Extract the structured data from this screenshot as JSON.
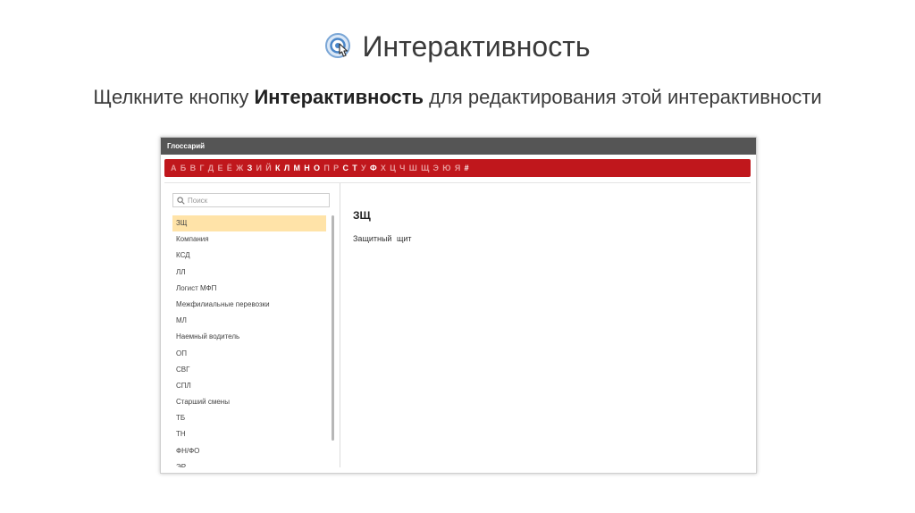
{
  "slide": {
    "title": "Интерактивность",
    "instruction_before": "Щелкните кнопку ",
    "instruction_bold": "Интерактивность",
    "instruction_after": " для редактирования этой интерактивности"
  },
  "glossary": {
    "header": "Глоссарий",
    "alphabet": [
      {
        "char": "А",
        "active": false
      },
      {
        "char": "Б",
        "active": false
      },
      {
        "char": "В",
        "active": false
      },
      {
        "char": "Г",
        "active": false
      },
      {
        "char": "Д",
        "active": false
      },
      {
        "char": "Е",
        "active": false
      },
      {
        "char": "Ё",
        "active": false
      },
      {
        "char": "Ж",
        "active": false
      },
      {
        "char": "З",
        "active": true
      },
      {
        "char": "И",
        "active": false
      },
      {
        "char": "Й",
        "active": false
      },
      {
        "char": "К",
        "active": true
      },
      {
        "char": "Л",
        "active": true
      },
      {
        "char": "М",
        "active": true
      },
      {
        "char": "Н",
        "active": true
      },
      {
        "char": "О",
        "active": true
      },
      {
        "char": "П",
        "active": false
      },
      {
        "char": "Р",
        "active": false
      },
      {
        "char": "С",
        "active": true
      },
      {
        "char": "Т",
        "active": true
      },
      {
        "char": "У",
        "active": false
      },
      {
        "char": "Ф",
        "active": true
      },
      {
        "char": "Х",
        "active": false
      },
      {
        "char": "Ц",
        "active": false
      },
      {
        "char": "Ч",
        "active": false
      },
      {
        "char": "Ш",
        "active": false
      },
      {
        "char": "Щ",
        "active": false
      },
      {
        "char": "Э",
        "active": false
      },
      {
        "char": "Ю",
        "active": false
      },
      {
        "char": "Я",
        "active": false
      },
      {
        "char": "#",
        "active": true
      }
    ],
    "search_placeholder": "Поиск",
    "terms": [
      "ЗЩ",
      "Компания",
      "КСД",
      "ЛЛ",
      "Логист МФП",
      "Межфилиальные перевозки",
      "МЛ",
      "Наемный водитель",
      "ОП",
      "СВГ",
      "СПЛ",
      "Старший смены",
      "ТБ",
      "ТН",
      "ФН/ФО",
      "ЭР"
    ],
    "selected_index": 0,
    "detail": {
      "term": "ЗЩ",
      "definition": "Защитный щит"
    }
  },
  "colors": {
    "header_bg": "#555555",
    "alphabet_bar": "#c0171c",
    "selected_term_bg": "#ffe3a8"
  },
  "icons": {
    "title_icon": "touch-interaction-icon",
    "search_icon": "search-icon"
  }
}
